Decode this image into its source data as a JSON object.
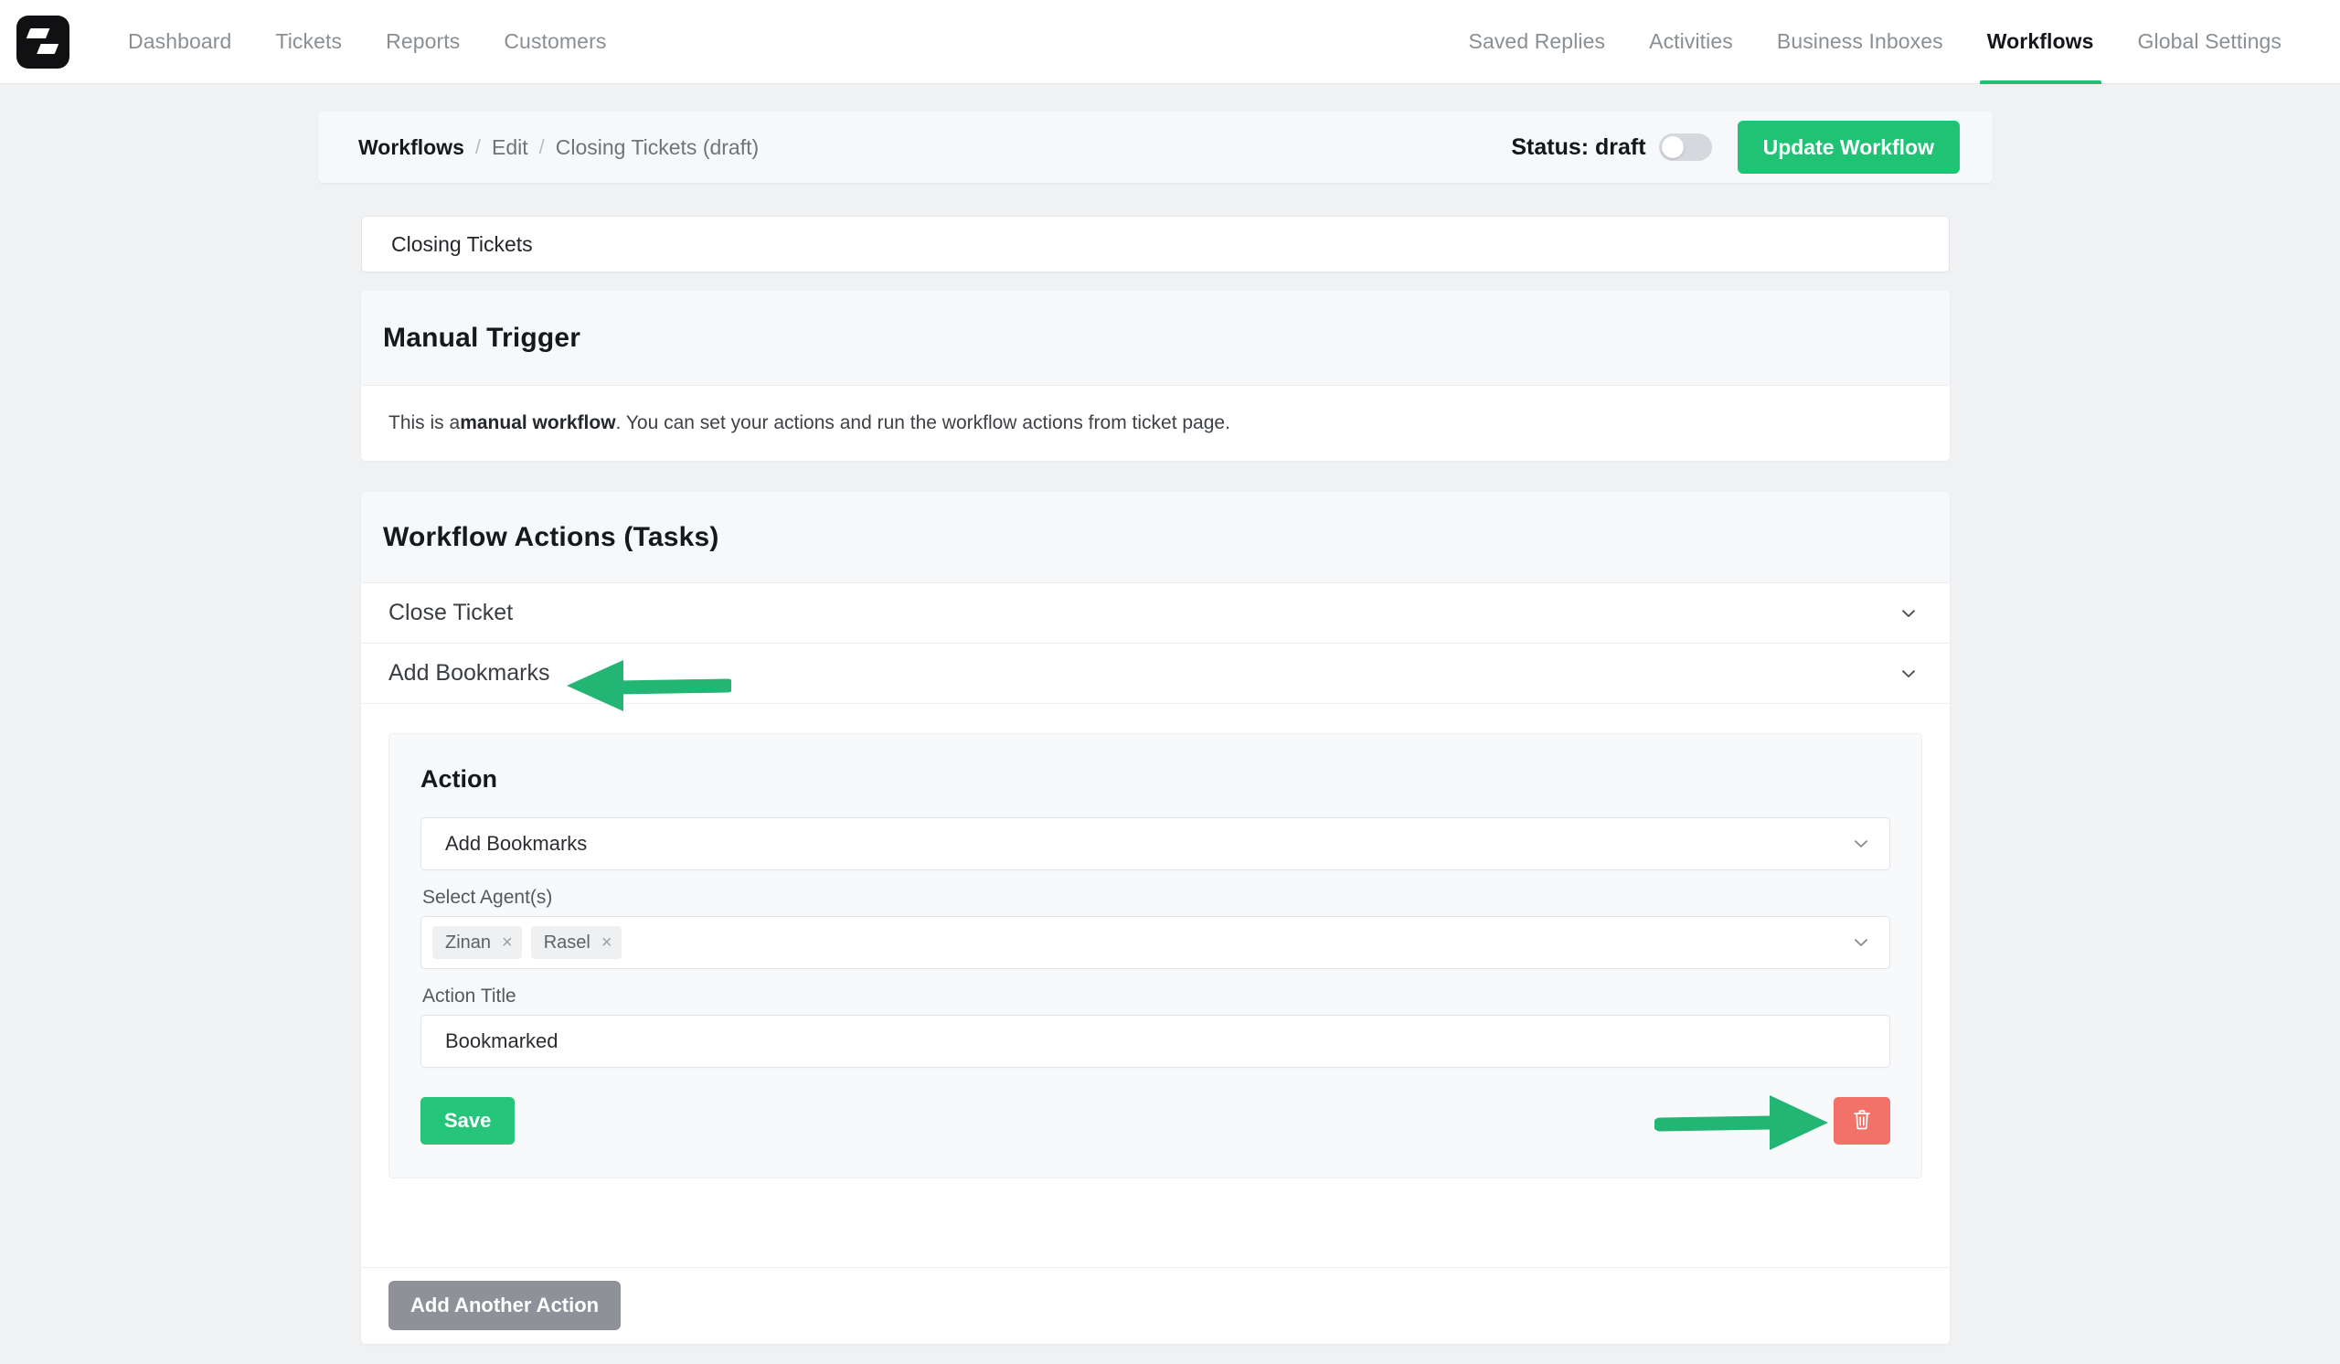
{
  "brand": {
    "logo_icon": "fluent-support-logo-icon"
  },
  "nav": {
    "left": [
      {
        "label": "Dashboard",
        "active": false
      },
      {
        "label": "Tickets",
        "active": false
      },
      {
        "label": "Reports",
        "active": false
      },
      {
        "label": "Customers",
        "active": false
      }
    ],
    "right": [
      {
        "label": "Saved Replies",
        "active": false
      },
      {
        "label": "Activities",
        "active": false
      },
      {
        "label": "Business Inboxes",
        "active": false
      },
      {
        "label": "Workflows",
        "active": true
      },
      {
        "label": "Global Settings",
        "active": false
      }
    ]
  },
  "breadcrumb": {
    "root": "Workflows",
    "sep": "/",
    "second": "Edit",
    "current": "Closing Tickets (draft)"
  },
  "status": {
    "label": "Status: draft",
    "toggle_on": false,
    "update_button": "Update Workflow"
  },
  "workflow_title": {
    "value": "Closing Tickets",
    "placeholder": "Workflow title"
  },
  "trigger": {
    "heading": "Manual Trigger",
    "text_before": "This is a ",
    "text_bold": "manual workflow",
    "text_after": ". You can set your actions and run the workflow actions from ticket page."
  },
  "actions": {
    "heading": "Workflow Actions (Tasks)",
    "items": [
      {
        "label": "Close Ticket",
        "expanded": false,
        "chevron": "chevron-down-icon"
      },
      {
        "label": "Add Bookmarks",
        "expanded": true,
        "chevron": "chevron-down-icon"
      }
    ],
    "panel": {
      "heading": "Action",
      "action_select": {
        "value": "Add Bookmarks",
        "chevron": "chevron-down-icon"
      },
      "agents_label": "Select Agent(s)",
      "agents": [
        {
          "name": "Zinan",
          "remove": "×"
        },
        {
          "name": "Rasel",
          "remove": "×"
        }
      ],
      "agents_chevron": "chevron-down-icon",
      "action_title_label": "Action Title",
      "action_title_value": "Bookmarked",
      "action_title_placeholder": "Action title",
      "save_button": "Save",
      "delete_button_icon": "trash-icon"
    },
    "add_another_button": "Add Another Action"
  },
  "annotations": [
    {
      "name": "arrow-pointing-to-add-bookmarks",
      "direction": "left",
      "color": "#23b573"
    },
    {
      "name": "arrow-pointing-to-delete-button",
      "direction": "right",
      "color": "#23b573"
    }
  ],
  "colors": {
    "accent_green": "#20c274",
    "save_green": "#25c57a",
    "delete_red": "#f2726a",
    "gray_button": "#8e9298",
    "page_bg": "#f0f1f2"
  }
}
